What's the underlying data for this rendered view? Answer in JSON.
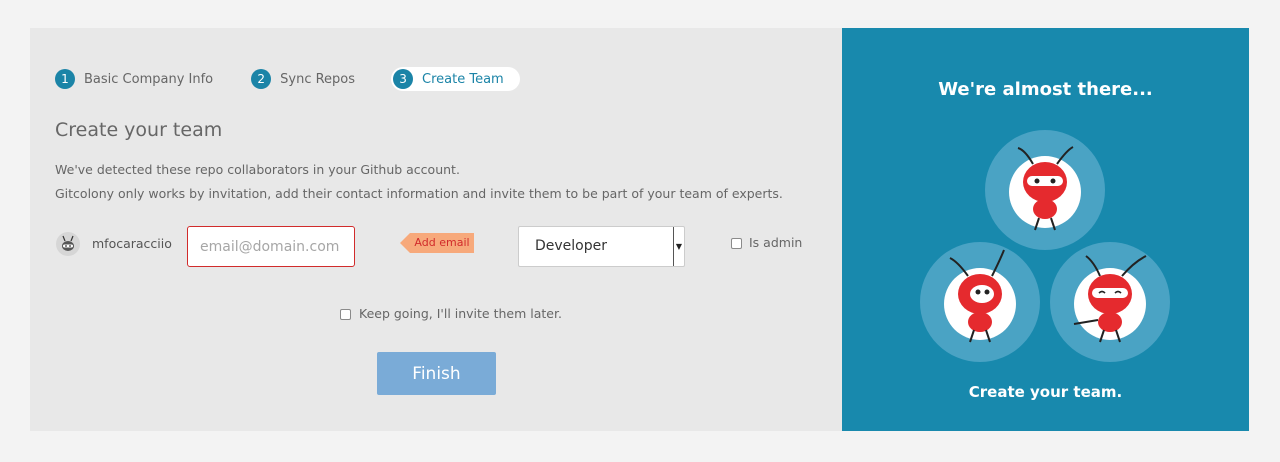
{
  "steps": [
    {
      "number": "1",
      "label": "Basic Company Info"
    },
    {
      "number": "2",
      "label": "Sync Repos"
    },
    {
      "number": "3",
      "label": "Create Team",
      "active": true
    }
  ],
  "main": {
    "title": "Create your team",
    "description_line1": "We've detected these repo collaborators in your Github account.",
    "description_line2": "Gitcolony only works by invitation, add their contact information and invite them to be part of your team of experts."
  },
  "collaborator": {
    "username": "mfocaracciio",
    "email_placeholder": "email@domain.com",
    "email_value": "",
    "error_badge": "Add email",
    "role_selected": "Developer",
    "is_admin_label": "Is admin",
    "is_admin_checked": false
  },
  "keep_going": {
    "label": "Keep going, I'll invite them later.",
    "checked": false
  },
  "finish_label": "Finish",
  "sidebar": {
    "title": "We're almost there...",
    "subtitle": "Create your team.",
    "mascot_icons": [
      "ant-mascot-icon",
      "ant-mascot-icon",
      "ant-mascot-icon"
    ]
  },
  "colors": {
    "accent": "#1b84a7",
    "sidebar_bg": "#1889ad",
    "error": "#d12b2b",
    "error_badge_bg": "#f7a97b",
    "finish_bg": "#7aabd7",
    "mascot_red": "#e52a2e"
  }
}
